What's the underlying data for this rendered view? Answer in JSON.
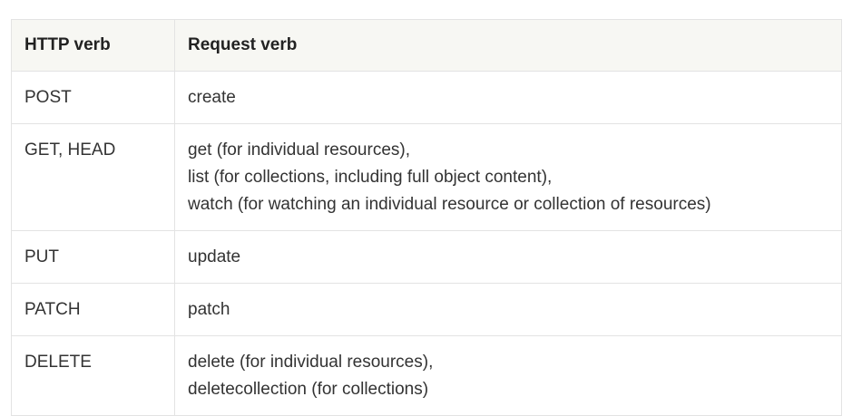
{
  "table": {
    "headers": [
      "HTTP verb",
      "Request verb"
    ],
    "rows": [
      {
        "http_verb": "POST",
        "request_verb": [
          "create"
        ]
      },
      {
        "http_verb": "GET, HEAD",
        "request_verb": [
          "get (for individual resources),",
          "list (for collections, including full object content),",
          "watch (for watching an individual resource or collection of resources)"
        ]
      },
      {
        "http_verb": "PUT",
        "request_verb": [
          "update"
        ]
      },
      {
        "http_verb": "PATCH",
        "request_verb": [
          "patch"
        ]
      },
      {
        "http_verb": "DELETE",
        "request_verb": [
          "delete (for individual resources),",
          "deletecollection (for collections)"
        ]
      }
    ]
  }
}
